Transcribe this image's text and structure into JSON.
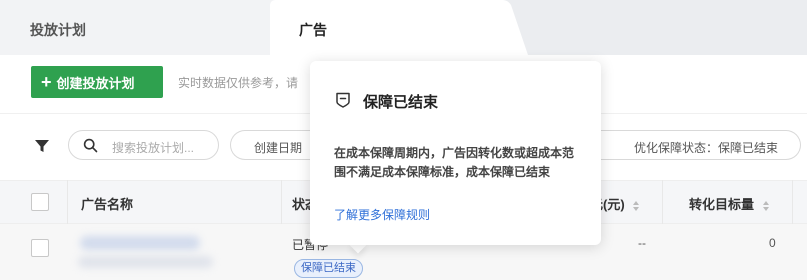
{
  "tabs": [
    {
      "label": "投放计划",
      "active": false
    },
    {
      "label": "广告",
      "active": true
    }
  ],
  "toolbar": {
    "create_label": "创建投放计划",
    "notice": "实时数据仅供参考，请"
  },
  "filters": {
    "search_placeholder": "搜索投放计划...",
    "date_label": "创建日期",
    "status_label": "优化保障状态：保障已结束"
  },
  "table": {
    "headers": {
      "name": "广告名称",
      "status": "状态",
      "cost": "元(元)",
      "target": "转化目标量"
    },
    "rows": [
      {
        "status": "已暂停",
        "badge": "保障已结束",
        "cost": "--",
        "target": "0"
      }
    ]
  },
  "popover": {
    "title": "保障已结束",
    "body": "在成本保障周期内，广告因转化数或超成本范围不满足成本保障标准，成本保障已结束",
    "link": "了解更多保障规则"
  },
  "colors": {
    "primary_green": "#2fa14f",
    "link_blue": "#2e6fd8",
    "badge_blue": "#3b67c4"
  }
}
